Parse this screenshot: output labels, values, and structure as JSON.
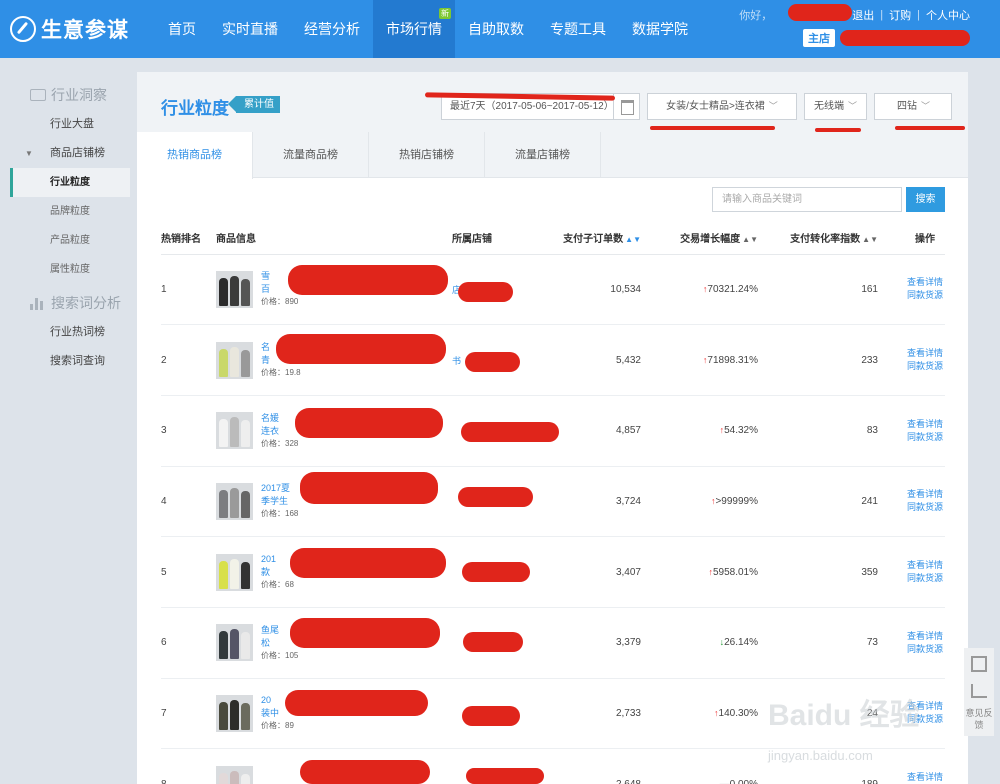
{
  "brand": "生意参谋",
  "nav": [
    {
      "label": "首页"
    },
    {
      "label": "实时直播"
    },
    {
      "label": "经营分析"
    },
    {
      "label": "市场行情",
      "badge": "新",
      "active": true
    },
    {
      "label": "自助取数"
    },
    {
      "label": "专题工具"
    },
    {
      "label": "数据学院"
    }
  ],
  "user": {
    "hello": "你好，",
    "logout": "退出",
    "order": "订购",
    "center": "个人中心",
    "shop_tag": "主店"
  },
  "sidebar": {
    "group1": "行业洞察",
    "items1": [
      "行业大盘",
      "商品店铺榜",
      "行业粒度",
      "品牌粒度",
      "产品粒度",
      "属性粒度"
    ],
    "group2": "搜索词分析",
    "items2": [
      "行业热词榜",
      "搜索词查询"
    ]
  },
  "page": {
    "title": "行业粒度",
    "tag": "累计值"
  },
  "filters": {
    "date": "最近7天（2017-05-06~2017-05-12）",
    "category": "女装/女士精品>连衣裙",
    "device": "无线端",
    "level": "四钻"
  },
  "tabs": [
    "热销商品榜",
    "流量商品榜",
    "热销店铺榜",
    "流量店铺榜"
  ],
  "search": {
    "placeholder": "请输入商品关键词",
    "button": "搜索"
  },
  "table": {
    "headers": {
      "rank": "热销排名",
      "product": "商品信息",
      "shop": "所属店铺",
      "orders": "支付子订单数",
      "growth": "交易增长幅度",
      "conv": "支付转化率指数",
      "ops": "操作"
    },
    "op_detail": "查看详情",
    "op_similar": "同款货源",
    "rows": [
      {
        "rank": "1",
        "name1": "雪",
        "name2": "百",
        "price": "价格：890",
        "shop": "店",
        "orders": "10,534",
        "growth": "70321.24%",
        "dir": "up",
        "conv": "161"
      },
      {
        "rank": "2",
        "name1": "名",
        "name2": "青",
        "price": "价格：19.8",
        "shop": "书",
        "orders": "5,432",
        "growth": "71898.31%",
        "dir": "up",
        "conv": "233"
      },
      {
        "rank": "3",
        "name1": "名媛",
        "name2": "连衣",
        "price": "价格：328",
        "shop": "",
        "orders": "4,857",
        "growth": "54.32%",
        "dir": "up",
        "conv": "83"
      },
      {
        "rank": "4",
        "name1": "2017夏",
        "name2": "季学生",
        "price": "价格：168",
        "shop": "",
        "orders": "3,724",
        "growth": ">99999%",
        "dir": "up",
        "conv": "241"
      },
      {
        "rank": "5",
        "name1": "201",
        "name2": "款",
        "price": "价格：68",
        "shop": "",
        "orders": "3,407",
        "growth": "5958.01%",
        "dir": "up",
        "conv": "359"
      },
      {
        "rank": "6",
        "name1": "鱼尾",
        "name2": "松",
        "price": "价格：105",
        "shop": "",
        "orders": "3,379",
        "growth": "26.14%",
        "dir": "down",
        "conv": "73"
      },
      {
        "rank": "7",
        "name1": "20",
        "name2": "装中",
        "price": "价格：89",
        "shop": "",
        "orders": "2,733",
        "growth": "140.30%",
        "dir": "up",
        "conv": "24"
      },
      {
        "rank": "8",
        "name1": "",
        "name2": "",
        "price": "",
        "shop": "",
        "orders": "2,648",
        "growth": "0.00%",
        "dir": "flat",
        "conv": "189"
      }
    ]
  },
  "float": {
    "feedback": "意见反馈"
  },
  "watermark": {
    "main": "Baidu 经验",
    "sub": "jingyan.baidu.com"
  }
}
